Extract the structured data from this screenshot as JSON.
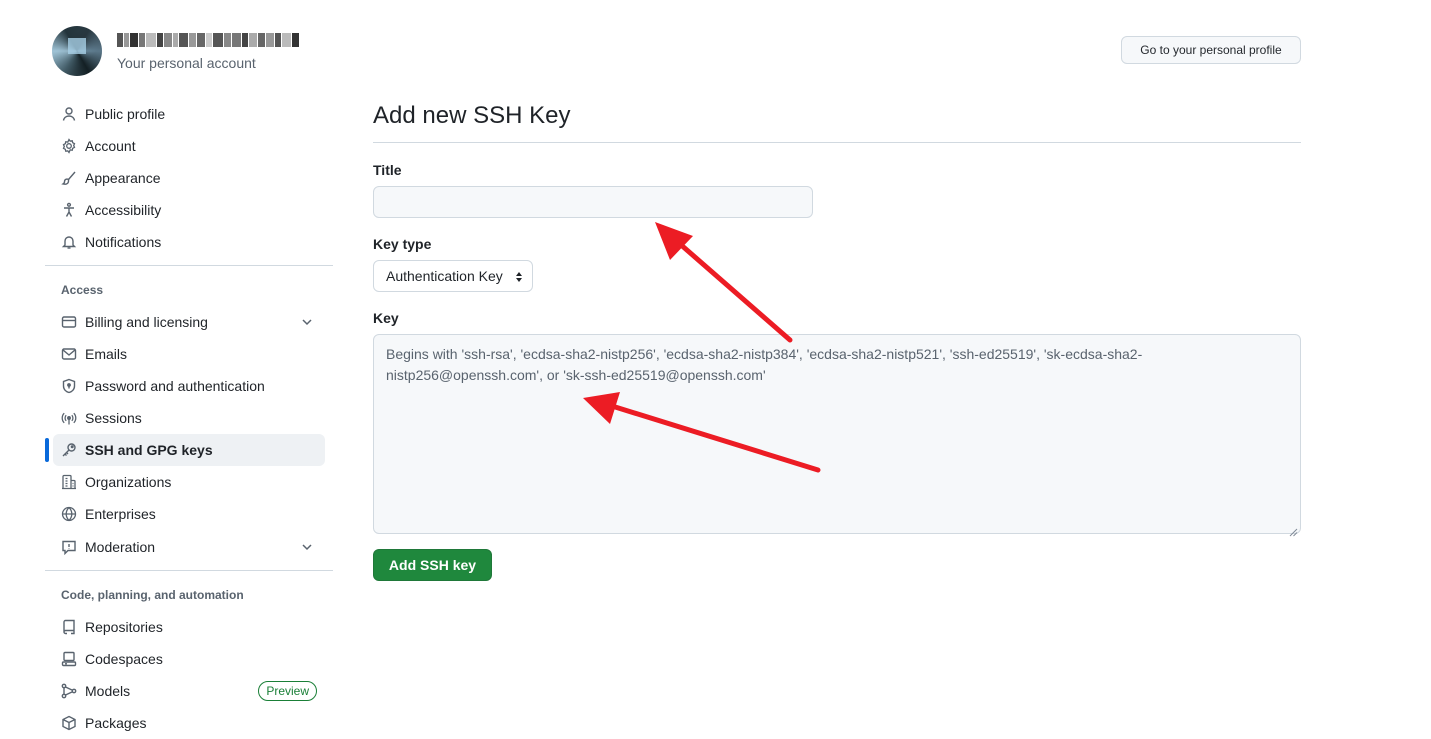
{
  "header": {
    "account_subtitle": "Your personal account",
    "profile_button": "Go to your personal profile"
  },
  "sidebar": {
    "items_top": [
      {
        "label": "Public profile",
        "icon": "person-icon"
      },
      {
        "label": "Account",
        "icon": "gear-icon"
      },
      {
        "label": "Appearance",
        "icon": "paintbrush-icon"
      },
      {
        "label": "Accessibility",
        "icon": "accessibility-icon"
      },
      {
        "label": "Notifications",
        "icon": "bell-icon"
      }
    ],
    "access_title": "Access",
    "items_access": [
      {
        "label": "Billing and licensing",
        "icon": "credit-card-icon"
      },
      {
        "label": "Emails",
        "icon": "mail-icon"
      },
      {
        "label": "Password and authentication",
        "icon": "shield-lock-icon"
      },
      {
        "label": "Sessions",
        "icon": "broadcast-icon"
      },
      {
        "label": "SSH and GPG keys",
        "icon": "key-icon"
      },
      {
        "label": "Organizations",
        "icon": "organization-icon"
      },
      {
        "label": "Enterprises",
        "icon": "globe-icon"
      },
      {
        "label": "Moderation",
        "icon": "report-icon"
      }
    ],
    "code_title": "Code, planning, and automation",
    "items_code": [
      {
        "label": "Repositories",
        "icon": "repo-icon"
      },
      {
        "label": "Codespaces",
        "icon": "codespaces-icon"
      },
      {
        "label": "Models",
        "icon": "models-icon",
        "badge": "Preview"
      },
      {
        "label": "Packages",
        "icon": "package-icon"
      }
    ]
  },
  "main": {
    "page_title": "Add new SSH Key",
    "title_label": "Title",
    "title_value": "",
    "key_type_label": "Key type",
    "key_type_selected": "Authentication Key",
    "key_label": "Key",
    "key_placeholder": "Begins with 'ssh-rsa', 'ecdsa-sha2-nistp256', 'ecdsa-sha2-nistp384', 'ecdsa-sha2-nistp521', 'ssh-ed25519', 'sk-ecdsa-sha2-nistp256@openssh.com', or 'sk-ssh-ed25519@openssh.com'",
    "submit_label": "Add SSH key"
  },
  "colors": {
    "accent": "#0969da",
    "primary_button": "#1f883d",
    "annotation_arrow": "#ec1c24"
  }
}
